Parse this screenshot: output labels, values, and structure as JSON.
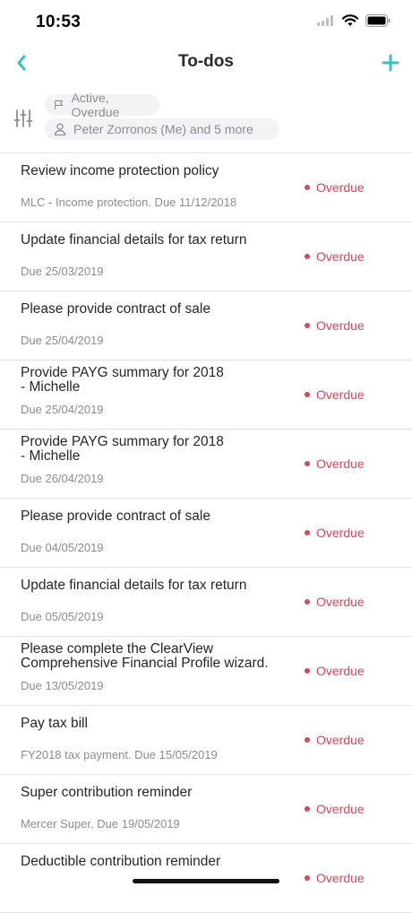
{
  "status_bar": {
    "time": "10:53"
  },
  "nav": {
    "title": "To-dos"
  },
  "filters": {
    "status_chip": "Active, Overdue",
    "people_chip": "Peter Zorronos (Me) and 5 more"
  },
  "colors": {
    "accent": "#39c3b4",
    "overdue": "#d24a5c",
    "muted": "#8c8c94"
  },
  "todos": [
    {
      "title": "Review income protection policy",
      "subtitle": "MLC - Income protection. Due 11/12/2018",
      "status": "Overdue"
    },
    {
      "title": "Update financial details for tax return",
      "subtitle": "Due 25/03/2019",
      "status": "Overdue"
    },
    {
      "title": "Please provide contract of sale",
      "subtitle": "Due 25/04/2019",
      "status": "Overdue"
    },
    {
      "title": "Provide PAYG summary for 2018\n- Michelle",
      "subtitle": "Due 25/04/2019",
      "status": "Overdue"
    },
    {
      "title": "Provide PAYG summary for 2018\n- Michelle",
      "subtitle": "Due 26/04/2019",
      "status": "Overdue"
    },
    {
      "title": "Please provide contract of sale",
      "subtitle": "Due 04/05/2019",
      "status": "Overdue"
    },
    {
      "title": "Update financial details for tax return",
      "subtitle": "Due 05/05/2019",
      "status": "Overdue"
    },
    {
      "title": "Please complete the ClearView\nComprehensive Financial Profile wizard.",
      "subtitle": "Due 13/05/2019",
      "status": "Overdue"
    },
    {
      "title": "Pay tax bill",
      "subtitle": "FY2018 tax payment. Due 15/05/2019",
      "status": "Overdue"
    },
    {
      "title": "Super contribution reminder",
      "subtitle": "Mercer Super. Due 19/05/2019",
      "status": "Overdue"
    },
    {
      "title": "Deductible contribution reminder",
      "subtitle": "",
      "status": "Overdue"
    }
  ]
}
